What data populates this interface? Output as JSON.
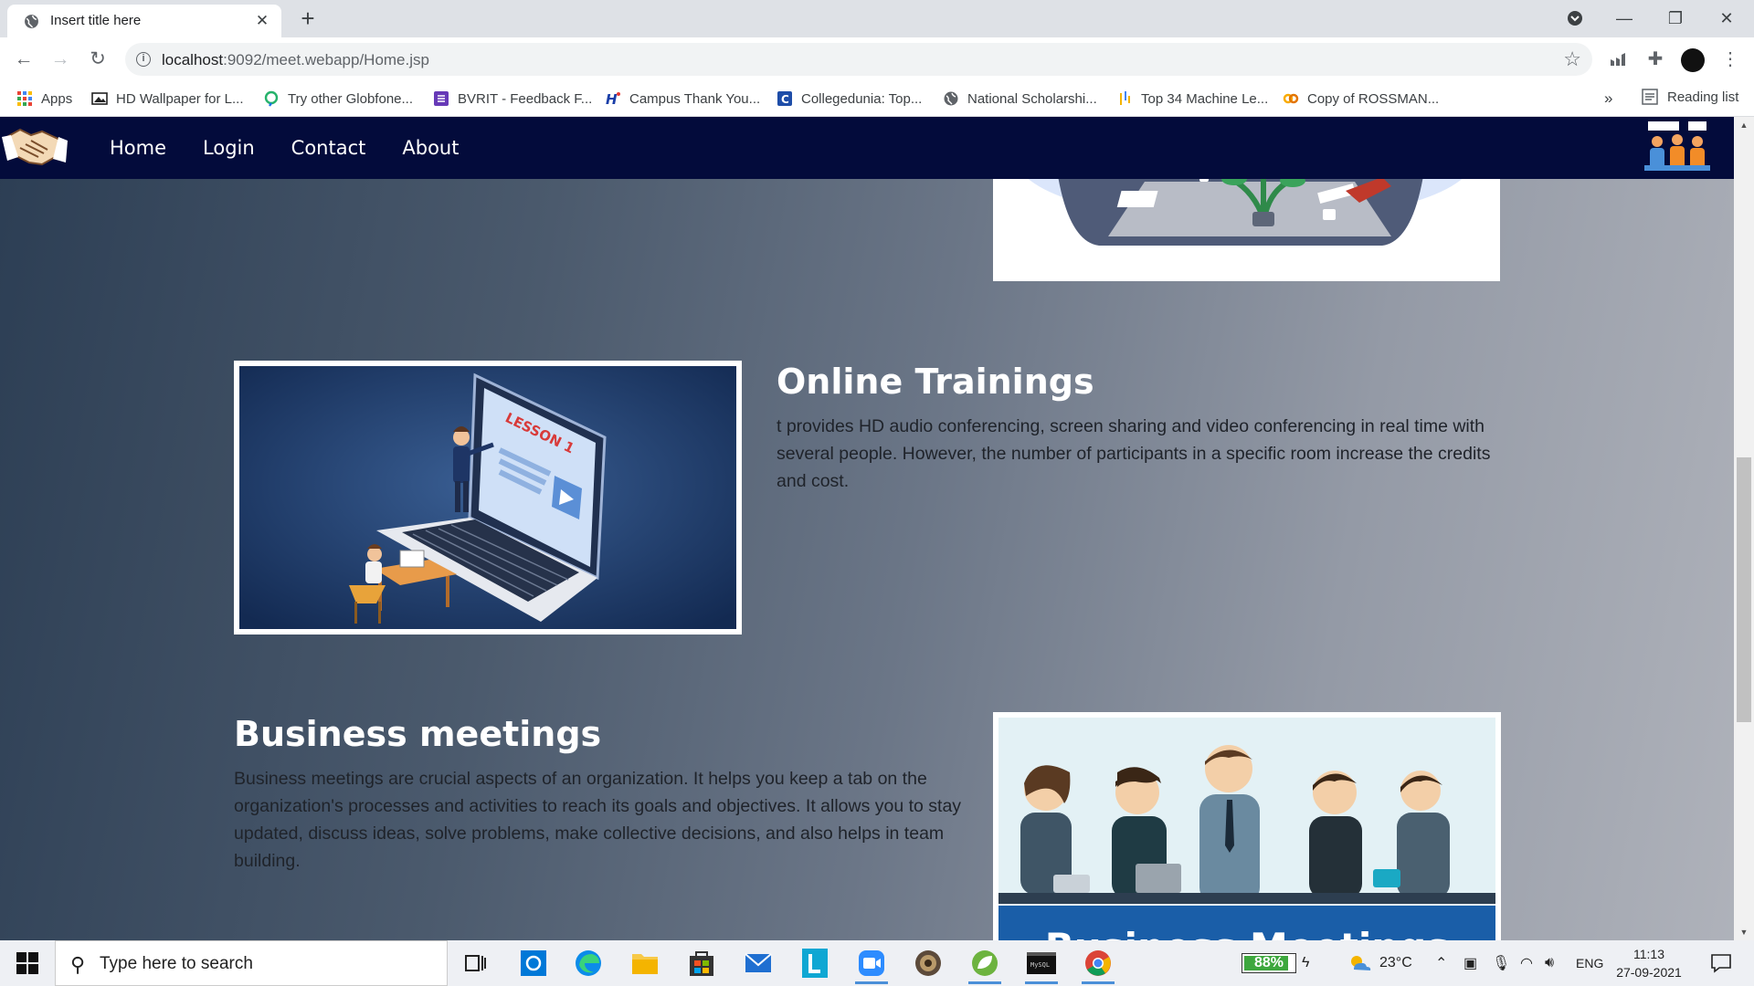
{
  "browser": {
    "tab_title": "Insert title here",
    "url_host": "localhost",
    "url_path": ":9092/meet.webapp/Home.jsp",
    "bookmarks": [
      {
        "label": "Apps",
        "icon": "apps-grid-icon"
      },
      {
        "label": "HD Wallpaper for L...",
        "icon": "image-icon"
      },
      {
        "label": "Try other Globfone...",
        "icon": "globfone-icon"
      },
      {
        "label": "BVRIT - Feedback F...",
        "icon": "form-icon"
      },
      {
        "label": "Campus Thank You...",
        "icon": "hi-icon"
      },
      {
        "label": "Collegedunia: Top...",
        "icon": "collegedunia-icon"
      },
      {
        "label": "National Scholarshi...",
        "icon": "globe-icon"
      },
      {
        "label": "Top 34 Machine Le...",
        "icon": "bars-icon"
      },
      {
        "label": "Copy of ROSSMAN...",
        "icon": "colab-icon"
      }
    ],
    "more_bookmarks": "»",
    "reading_list": "Reading list"
  },
  "site": {
    "nav": {
      "items": [
        "Home",
        "Login",
        "Contact",
        "About"
      ]
    },
    "sections": [
      {
        "title": "Online Trainings",
        "text": "t provides HD audio conferencing, screen sharing and video conferencing in real time with several people. However, the number of participants in a specific room increase the credits and cost.",
        "image_caption": "LESSON 1"
      },
      {
        "title": "Business meetings",
        "text": "Business meetings are crucial aspects of an organization. It helps you keep a tab on the organization's processes and activities to reach its goals and objectives. It allows you to stay updated, discuss ideas, solve problems, make collective decisions, and also helps in team building.",
        "image_caption": "Business Meetings"
      }
    ]
  },
  "taskbar": {
    "search_placeholder": "Type here to search",
    "battery": "88%",
    "battery_level": 0.88,
    "temperature": "23°C",
    "language": "ENG",
    "time": "11:13",
    "date": "27-09-2021"
  },
  "colors": {
    "site_nav_bg": "#030b3b",
    "accent_blue": "#1a5ea8"
  }
}
